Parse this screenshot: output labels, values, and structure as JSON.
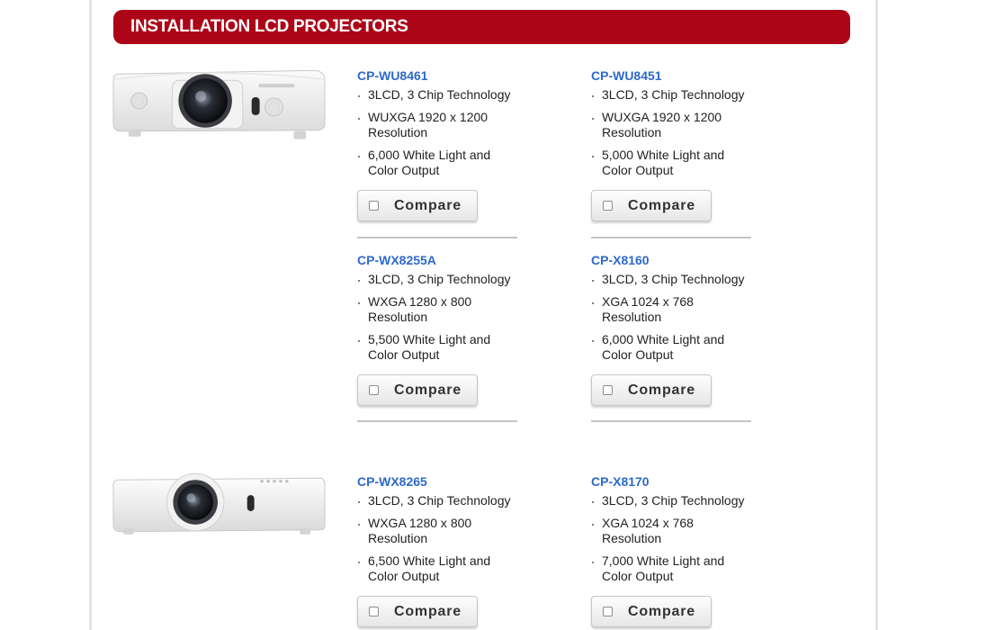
{
  "section": {
    "title": "INSTALLATION LCD PROJECTORS"
  },
  "colors": {
    "banner": "#ad0518",
    "link": "#2e69c9"
  },
  "compare_label": "Compare",
  "groups": [
    {
      "image": "projector-large-image",
      "products": [
        {
          "name": "CP-WU8461",
          "features": [
            "3LCD, 3 Chip Technology",
            "WUXGA 1920 x 1200 Resolution",
            "6,000 White Light and Color Output"
          ]
        },
        {
          "name": "CP-WU8451",
          "features": [
            "3LCD, 3 Chip Technology",
            "WUXGA 1920 x 1200 Resolution",
            "5,000 White Light and Color Output"
          ]
        },
        {
          "name": "CP-WX8255A",
          "features": [
            "3LCD, 3 Chip Technology",
            "WXGA 1280 x 800 Resolution",
            "5,500 White Light and Color Output"
          ]
        },
        {
          "name": "CP-X8160",
          "features": [
            "3LCD, 3 Chip Technology",
            "XGA 1024 x 768 Resolution",
            "6,000 White Light and Color Output"
          ]
        }
      ]
    },
    {
      "image": "projector-compact-image",
      "products": [
        {
          "name": "CP-WX8265",
          "features": [
            "3LCD, 3 Chip Technology",
            "WXGA 1280 x 800 Resolution",
            "6,500 White Light and Color Output"
          ]
        },
        {
          "name": "CP-X8170",
          "features": [
            "3LCD, 3 Chip Technology",
            "XGA 1024 x 768 Resolution",
            "7,000 White Light and Color Output"
          ]
        }
      ]
    }
  ]
}
